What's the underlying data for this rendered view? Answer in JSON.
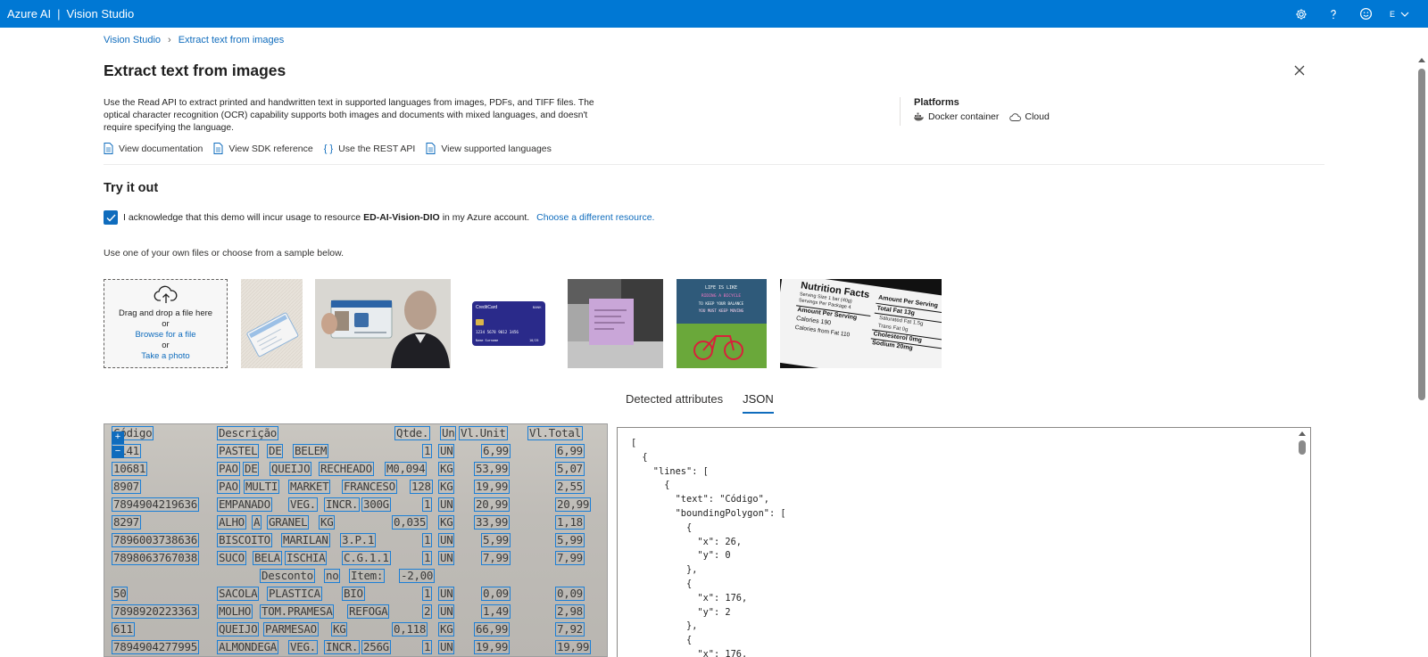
{
  "app": {
    "brand": "Azure AI",
    "product": "Vision Studio",
    "account_initial": "E"
  },
  "topbar_icons": [
    "settings-icon",
    "help-icon",
    "feedback-smiley-icon"
  ],
  "breadcrumb": {
    "root": "Vision Studio",
    "current": "Extract text from images"
  },
  "page": {
    "title": "Extract text from images",
    "description": "Use the Read API to extract printed and handwritten text in supported languages from images, PDFs, and TIFF files. The optical character recognition (OCR) capability supports both images and documents with mixed languages, and doesn't require specifying the language.",
    "links": [
      {
        "label": "View documentation",
        "icon": "document-icon"
      },
      {
        "label": "View SDK reference",
        "icon": "document-icon"
      },
      {
        "label": "Use the REST API",
        "icon": "braces-icon"
      },
      {
        "label": "View supported languages",
        "icon": "document-icon"
      }
    ]
  },
  "platforms": {
    "title": "Platforms",
    "items": [
      {
        "label": "Docker container",
        "icon": "docker-icon"
      },
      {
        "label": "Cloud",
        "icon": "cloud-icon"
      }
    ]
  },
  "try_it": {
    "title": "Try it out",
    "ack_prefix": "I acknowledge that this demo will incur usage to resource",
    "ack_resource": "ED-AI-Vision-DIO",
    "ack_suffix": "in my Azure account.",
    "change_resource": "Choose a different resource.",
    "use_files": "Use one of your own files or choose from a sample below."
  },
  "dropzone": {
    "drag_text": "Drag and drop a file here",
    "or1": "or",
    "browse": "Browse for a file",
    "or2": "or",
    "take_photo": "Take a photo"
  },
  "samples": {
    "creditcard_brand": "CreditCard",
    "creditcard_bank": "BANK",
    "creditcard_number": "1234 5678 9012 3456",
    "creditcard_name": "Name Surname",
    "creditcard_expiry": "10/25",
    "poster_lines": [
      "LIFE IS LIKE",
      "RIDING A BICYCLE",
      "TO KEEP YOUR BALANCE",
      "YOU MUST KEEP MOVING"
    ],
    "nutrition": {
      "title": "Nutrition Facts",
      "serving_size": "Serving Size 1 bar (40g)",
      "servings": "Servings Per Package 4",
      "amount": "Amount Per Serving",
      "calories": "Calories 190",
      "fat_cal": "Calories from Fat 110",
      "total_fat": "Total Fat 13g",
      "sat_fat": "Saturated Fat 1.5g",
      "trans_fat": "Trans Fat 0g",
      "chol": "Cholesterol 0mg",
      "sodium": "Sodium 20mg"
    }
  },
  "tabs": [
    {
      "label": "Detected attributes",
      "active": false
    },
    {
      "label": "JSON",
      "active": true
    }
  ],
  "receipt_words": [
    "Código",
    "Descrição",
    "Qtde.",
    "Un",
    "Vl.Unit",
    "Vl.Total",
    "0141",
    "PASTEL",
    "DE",
    "BELEM",
    "1",
    "UN",
    "6,99",
    "6,99",
    "10681",
    "PAO",
    "DE",
    "QUEIJO",
    "RECHEADO",
    "M0,094",
    "KG",
    "53,99",
    "5,07",
    "8907",
    "PAO",
    "MULTI",
    "MARKET",
    "FRANCESO",
    "128",
    "KG",
    "19,99",
    "2,55",
    "7894904219636",
    "EMPANADO",
    "VEG.",
    "INCR.",
    "300G",
    "1",
    "UN",
    "20,99",
    "20,99",
    "8297",
    "ALHO",
    "A",
    "GRANEL",
    "KG",
    "0,035",
    "KG",
    "33,99",
    "1,18",
    "7896003738636",
    "BISCOITO",
    "MARILAN",
    "3.P.1",
    "1",
    "UN",
    "5,99",
    "5,99",
    "7898063767038",
    "SUCO",
    "BELA",
    "ISCHIA",
    "C.G.1.1",
    "1",
    "UN",
    "7,99",
    "7,99",
    "Desconto",
    "no",
    "Item:",
    "-2,00",
    "50",
    "SACOLA",
    "PLASTICA",
    "BIO",
    "1",
    "UN",
    "0,09",
    "0,09",
    "7898920223363",
    "MOLHO",
    "TOM.PRAMESA",
    "REFOGA",
    "2",
    "UN",
    "1,49",
    "2,98",
    "611",
    "QUEIJO",
    "PARMESAO",
    "KG",
    "0,118",
    "KG",
    "66,99",
    "7,92",
    "7894904277995",
    "ALMONDEGA",
    "VEG.",
    "INCR.",
    "256G",
    "1",
    "UN",
    "19,99",
    "19,99"
  ],
  "json_lines": [
    "[",
    "  {",
    "    \"lines\": [",
    "      {",
    "        \"text\": \"Código\",",
    "        \"boundingPolygon\": [",
    "          {",
    "            \"x\": 26,",
    "            \"y\": 0",
    "          },",
    "          {",
    "            \"x\": 176,",
    "            \"y\": 2",
    "          },",
    "          {",
    "            \"x\": 176,"
  ],
  "colors": {
    "topbar": "#0078d4",
    "link": "#0f6cbd",
    "ocr_box": "#1c7fd6"
  }
}
